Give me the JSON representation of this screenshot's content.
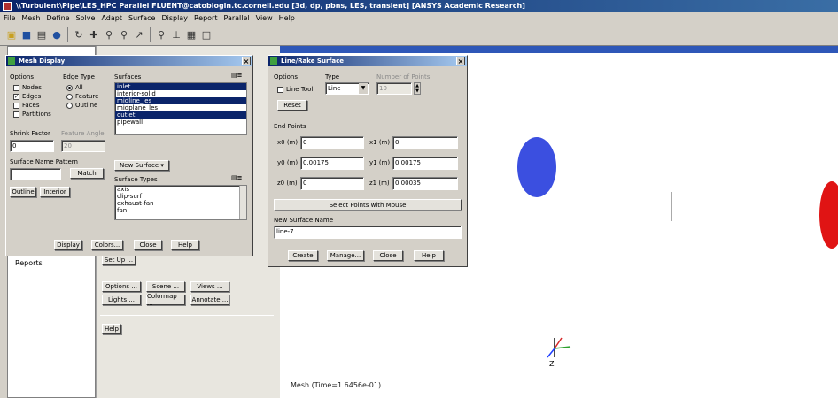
{
  "window": {
    "title": "\\\\Turbulent\\Pipe\\LES_HPC Parallel FLUENT@catoblogin.tc.cornell.edu [3d, dp, pbns, LES, transient] [ANSYS Academic Research]"
  },
  "menu": [
    "File",
    "Mesh",
    "Define",
    "Solve",
    "Adapt",
    "Surface",
    "Display",
    "Report",
    "Parallel",
    "View",
    "Help"
  ],
  "toolbar": {
    "icons": [
      "open-icon",
      "save-icon",
      "print-icon",
      "camera-icon",
      "rotate-icon",
      "pan-icon",
      "zoom-icon",
      "zoom-box-icon",
      "probe-icon",
      "fit-icon",
      "measure-icon",
      "layout-icon",
      "window-icon"
    ]
  },
  "left": {
    "tree_item": "Reports",
    "task_buttons": {
      "setup": "Set Up ...",
      "options": "Options ...",
      "scene": "Scene ...",
      "views": "Views ...",
      "lights": "Lights ...",
      "colormap": "Colormap ...",
      "annotate": "Annotate ...",
      "help": "Help"
    }
  },
  "mesh_display": {
    "title": "Mesh Display",
    "options_label": "Options",
    "options": [
      {
        "label": "Nodes",
        "checked": false
      },
      {
        "label": "Edges",
        "checked": true
      },
      {
        "label": "Faces",
        "checked": false
      },
      {
        "label": "Partitions",
        "checked": false
      }
    ],
    "edge_type_label": "Edge Type",
    "edge_types": [
      {
        "label": "All",
        "selected": true
      },
      {
        "label": "Feature",
        "selected": false
      },
      {
        "label": "Outline",
        "selected": false
      }
    ],
    "surfaces_label": "Surfaces",
    "surfaces": [
      {
        "name": "inlet",
        "selected": true
      },
      {
        "name": "interior-solid",
        "selected": false
      },
      {
        "name": "midline_les",
        "selected": true
      },
      {
        "name": "midplane_les",
        "selected": false
      },
      {
        "name": "outlet",
        "selected": true
      },
      {
        "name": "pipewall",
        "selected": false
      }
    ],
    "shrink_factor_label": "Shrink Factor",
    "shrink_factor": "0",
    "feature_angle_label": "Feature Angle",
    "feature_angle": "20",
    "surface_name_pattern_label": "Surface Name Pattern",
    "surface_name_pattern": "",
    "match_label": "Match",
    "outline_label": "Outline",
    "interior_label": "Interior",
    "new_surface_label": "New Surface ▾",
    "surface_types_label": "Surface Types",
    "surface_types": [
      "axis",
      "clip-surf",
      "exhaust-fan",
      "fan"
    ],
    "buttons": {
      "display": "Display",
      "colors": "Colors...",
      "close": "Close",
      "help": "Help"
    }
  },
  "line_rake": {
    "title": "Line/Rake Surface",
    "options_label": "Options",
    "line_tool_label": "Line Tool",
    "reset_label": "Reset",
    "type_label": "Type",
    "type_value": "Line",
    "num_points_label": "Number of Points",
    "num_points": "10",
    "end_points_label": "End Points",
    "x0_label": "x0 (m)",
    "x0": "0",
    "y0_label": "y0 (m)",
    "y0": "0.00175",
    "z0_label": "z0 (m)",
    "z0": "0",
    "x1_label": "x1 (m)",
    "x1": "0",
    "y1_label": "y1 (m)",
    "y1": "0.00175",
    "z1_label": "z1 (m)",
    "z1": "0.00035",
    "select_points_label": "Select Points with Mouse",
    "new_surface_name_label": "New Surface Name",
    "new_surface_name": "line-7",
    "buttons": {
      "create": "Create",
      "manage": "Manage...",
      "close": "Close",
      "help": "Help"
    }
  },
  "viewport": {
    "status": "Mesh  (Time=1.6456e-01)",
    "inlet_color": "#3b4fe0",
    "outlet_color": "#e01414"
  }
}
